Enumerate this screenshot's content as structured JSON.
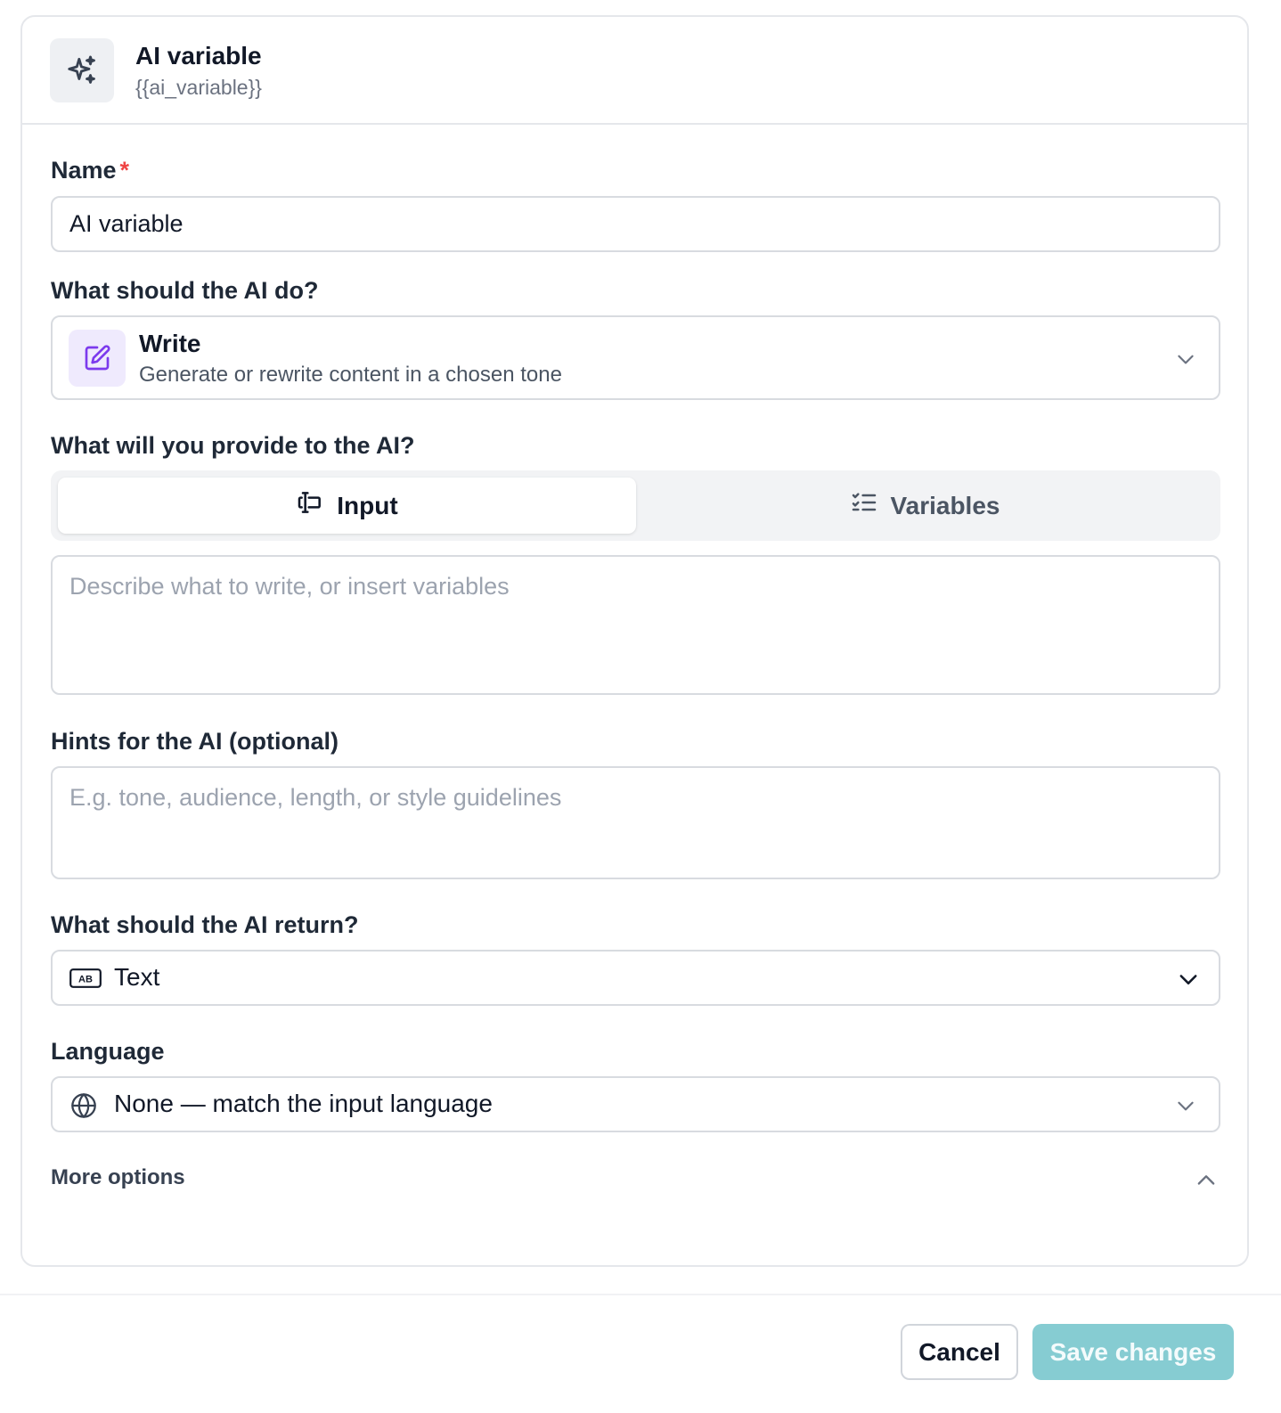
{
  "header": {
    "title": "AI variable",
    "subtitle": "{{ai_variable}}",
    "icon": "sparkles-icon"
  },
  "name_field": {
    "label": "Name",
    "required_mark": "*",
    "value": "AI variable"
  },
  "action_field": {
    "label": "What should the AI do?",
    "selected_title": "Write",
    "selected_description": "Generate or rewrite content in a chosen tone",
    "icon": "edit-icon"
  },
  "provide_field": {
    "label": "What will you provide to the AI?",
    "tabs": [
      {
        "label": "Input",
        "icon": "text-cursor-input-icon",
        "active": true
      },
      {
        "label": "Variables",
        "icon": "list-checks-icon",
        "active": false
      }
    ],
    "placeholder": "Describe what to write, or insert variables"
  },
  "hints_field": {
    "label": "Hints for the AI (optional)",
    "placeholder": "E.g. tone, audience, length, or style guidelines"
  },
  "return_field": {
    "label": "What should the AI return?",
    "selected": "Text",
    "icon": "text-type-icon",
    "icon_text": "AB"
  },
  "language_field": {
    "label": "Language",
    "selected": "None — match the input language",
    "icon": "globe-icon"
  },
  "more_options": {
    "label": "More options"
  },
  "footer": {
    "cancel_label": "Cancel",
    "save_label": "Save changes"
  },
  "colors": {
    "accent_disabled": "#86ccd2",
    "required": "#ef4444",
    "write_icon": "#7c3aed"
  }
}
